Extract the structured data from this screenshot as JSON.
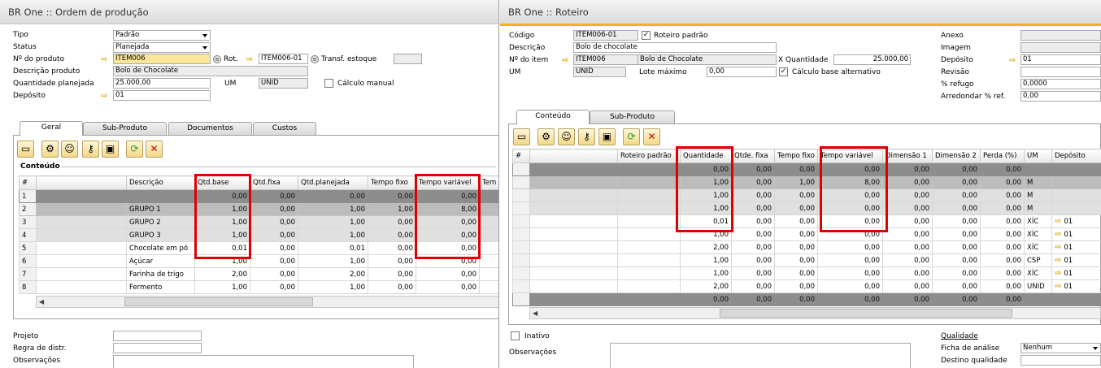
{
  "left": {
    "title": "BR One :: Ordem de produção",
    "form": {
      "tipo_label": "Tipo",
      "tipo_value": "Padrão",
      "status_label": "Status",
      "status_value": "Planejada",
      "produto_label": "Nº do produto",
      "produto_value": "ITEM006",
      "rot_label": "Rot.",
      "rot_value": "ITEM006-01",
      "transf_label": "Transf. estoque",
      "descricao_label": "Descrição produto",
      "descricao_value": "Bolo de Chocolate",
      "qtd_label": "Quantidade planejada",
      "qtd_value": "25.000,00",
      "um_label": "UM",
      "um_value": "UNID",
      "calc_label": "Cálculo manual",
      "deposito_label": "Depósito",
      "deposito_value": "01"
    },
    "tabs": [
      "Geral",
      "Sub-Produto",
      "Documentos",
      "Custos"
    ],
    "section_title": "Conteúdo",
    "grid": {
      "headers": [
        "#",
        "",
        "Descrição",
        "Qtd.base",
        "Qtd.fixa",
        "Qtd.planejada",
        "Tempo fixo",
        "Tempo variável",
        "Tem"
      ],
      "rows": [
        {
          "n": "1",
          "desc": "",
          "base": "0,00",
          "fixa": "0,00",
          "plan": "0,00",
          "tfixo": "0,00",
          "tvar": "0,00"
        },
        {
          "n": "2",
          "desc": "GRUPO 1",
          "base": "1,00",
          "fixa": "0,00",
          "plan": "1,00",
          "tfixo": "1,00",
          "tvar": "8,00"
        },
        {
          "n": "3",
          "desc": "GRUPO 2",
          "base": "1,00",
          "fixa": "0,00",
          "plan": "1,00",
          "tfixo": "0,00",
          "tvar": "0,00"
        },
        {
          "n": "4",
          "desc": "GRUPO 3",
          "base": "1,00",
          "fixa": "0,00",
          "plan": "1,00",
          "tfixo": "0,00",
          "tvar": "0,00"
        },
        {
          "n": "5",
          "desc": "Chocolate em pó",
          "base": "0,01",
          "fixa": "0,00",
          "plan": "0,01",
          "tfixo": "0,00",
          "tvar": "0,00"
        },
        {
          "n": "6",
          "desc": "Açúcar",
          "base": "1,00",
          "fixa": "0,00",
          "plan": "1,00",
          "tfixo": "0,00",
          "tvar": "0,00"
        },
        {
          "n": "7",
          "desc": "Farinha de trigo",
          "base": "2,00",
          "fixa": "0,00",
          "plan": "2,00",
          "tfixo": "0,00",
          "tvar": "0,00"
        },
        {
          "n": "8",
          "desc": "Fermento",
          "base": "1,00",
          "fixa": "0,00",
          "plan": "1,00",
          "tfixo": "0,00",
          "tvar": "0,00"
        }
      ]
    },
    "bottom": {
      "projeto_label": "Projeto",
      "regra_label": "Regra de distr.",
      "obs_label": "Observações"
    }
  },
  "right": {
    "title": "BR One :: Roteiro",
    "form": {
      "codigo_label": "Código",
      "codigo_value": "ITEM006-01",
      "roteiro_padrao_label": "Roteiro padrão",
      "descricao_label": "Descrição",
      "descricao_value": "Bolo de chocolate",
      "item_label": "Nº do item",
      "item_value": "ITEM006",
      "item_desc": "Bolo de Chocolate",
      "xqtd_label": "X Quantidade",
      "xqtd_value": "25.000,00",
      "um_label": "UM",
      "um_value": "UNID",
      "lote_label": "Lote máximo",
      "lote_value": "0,00",
      "calc_alt_label": "Cálculo base alternativo",
      "anexo_label": "Anexo",
      "imagem_label": "Imagem",
      "deposito_label": "Depósito",
      "deposito_value": "01",
      "revisao_label": "Revisão",
      "refugo_label": "% refugo",
      "refugo_value": "0,0000",
      "arred_label": "Arredondar % ref.",
      "arred_value": "0,00"
    },
    "tabs": [
      "Conteúdo",
      "Sub-Produto"
    ],
    "grid": {
      "headers": [
        "#",
        "",
        "Roteiro padrão",
        "Quantidade",
        "Qtde. fixa",
        "Tempo fixo",
        "Tempo variável",
        "Dimensão 1",
        "Dimensão 2",
        "Perda (%)",
        "UM",
        "Depósito"
      ],
      "rows": [
        {
          "q": "0,00",
          "qf": "0,00",
          "tf": "0,00",
          "tv": "0,00",
          "d1": "0,00",
          "d2": "0,00",
          "p": "0,00",
          "um": "",
          "dep": ""
        },
        {
          "q": "1,00",
          "qf": "0,00",
          "tf": "1,00",
          "tv": "8,00",
          "d1": "0,00",
          "d2": "0,00",
          "p": "0,00",
          "um": "M",
          "dep": ""
        },
        {
          "q": "1,00",
          "qf": "0,00",
          "tf": "0,00",
          "tv": "0,00",
          "d1": "0,00",
          "d2": "0,00",
          "p": "0,00",
          "um": "M",
          "dep": ""
        },
        {
          "q": "1,00",
          "qf": "0,00",
          "tf": "0,00",
          "tv": "0,00",
          "d1": "0,00",
          "d2": "0,00",
          "p": "0,00",
          "um": "M",
          "dep": ""
        },
        {
          "q": "0,01",
          "qf": "0,00",
          "tf": "0,00",
          "tv": "0,00",
          "d1": "0,00",
          "d2": "0,00",
          "p": "0,00",
          "um": "XÍC",
          "dep": "01"
        },
        {
          "q": "1,00",
          "qf": "0,00",
          "tf": "0,00",
          "tv": "0,00",
          "d1": "0,00",
          "d2": "0,00",
          "p": "0,00",
          "um": "XÍC",
          "dep": "01"
        },
        {
          "q": "2,00",
          "qf": "0,00",
          "tf": "0,00",
          "tv": "0,00",
          "d1": "0,00",
          "d2": "0,00",
          "p": "0,00",
          "um": "XÍC",
          "dep": "01"
        },
        {
          "q": "1,00",
          "qf": "0,00",
          "tf": "0,00",
          "tv": "0,00",
          "d1": "0,00",
          "d2": "0,00",
          "p": "0,00",
          "um": "CSP",
          "dep": "01"
        },
        {
          "q": "1,00",
          "qf": "0,00",
          "tf": "0,00",
          "tv": "0,00",
          "d1": "0,00",
          "d2": "0,00",
          "p": "0,00",
          "um": "XÍC",
          "dep": "01"
        },
        {
          "q": "2,00",
          "qf": "0,00",
          "tf": "0,00",
          "tv": "0,00",
          "d1": "0,00",
          "d2": "0,00",
          "p": "0,00",
          "um": "UNID",
          "dep": "01"
        },
        {
          "q": "0,00",
          "qf": "0,00",
          "tf": "0,00",
          "tv": "0,00",
          "d1": "0,00",
          "d2": "0,00",
          "p": "0,00",
          "um": "",
          "dep": ""
        }
      ]
    },
    "bottom": {
      "inativo_label": "Inativo",
      "obs_label": "Observações",
      "qualidade_label": "Qualidade",
      "ficha_label": "Ficha de análise",
      "ficha_value": "Nenhum",
      "destino_label": "Destino qualidade"
    }
  },
  "colors": {
    "highlight_red": "#e00000",
    "accent": "#f2b31a",
    "required_field": "#fbe79a"
  },
  "icons": [
    "folder-open-icon",
    "gear-icon",
    "users-icon",
    "key-icon",
    "cube-icon",
    "refresh-icon",
    "delete-icon",
    "link-arrow-icon",
    "info-circle-icon"
  ]
}
